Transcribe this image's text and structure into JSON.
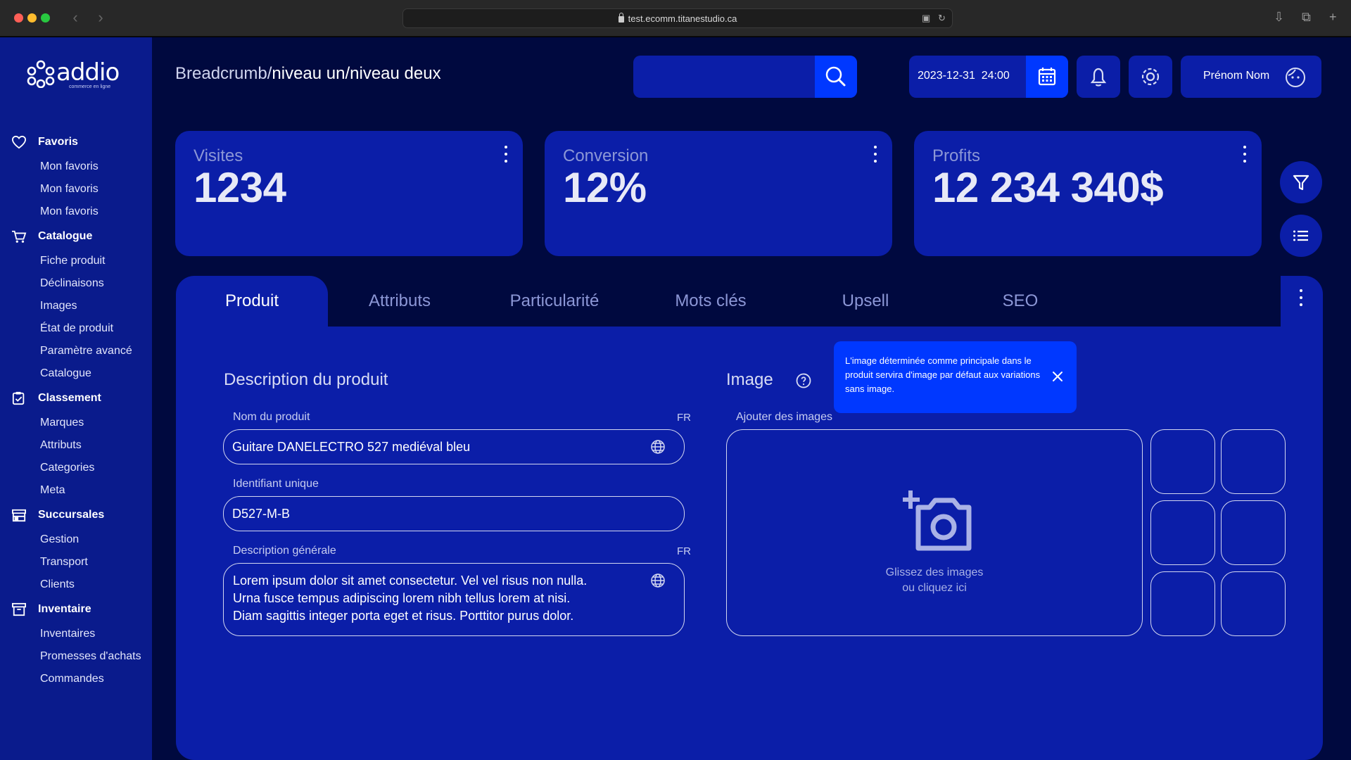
{
  "browser": {
    "url": "test.ecomm.titanestudio.ca"
  },
  "logo": {
    "name": "addio",
    "tagline": "commerce en ligne"
  },
  "sidebar": {
    "sections": [
      {
        "title": "Favoris",
        "icon": "heart-icon",
        "items": [
          "Mon favoris",
          "Mon favoris",
          "Mon favoris"
        ]
      },
      {
        "title": "Catalogue",
        "icon": "cart-icon",
        "items": [
          "Fiche produit",
          "Déclinaisons",
          "Images",
          "État de produit",
          "Paramètre avancé",
          "Catalogue"
        ]
      },
      {
        "title": "Classement",
        "icon": "clipboard-check-icon",
        "items": [
          "Marques",
          "Attributs",
          "Categories",
          "Meta"
        ]
      },
      {
        "title": "Succursales",
        "icon": "store-icon",
        "items": [
          "Gestion",
          "Transport",
          "Clients"
        ]
      },
      {
        "title": "Inventaire",
        "icon": "archive-icon",
        "items": [
          "Inventaires",
          "Promesses d'achats",
          "Commandes"
        ]
      }
    ]
  },
  "header": {
    "breadcrumb": {
      "root": "Breadcrumb/",
      "level1": "niveau un/",
      "level2": "niveau deux"
    },
    "search": {
      "value": "",
      "placeholder": ""
    },
    "date": {
      "value": "2023-12-31",
      "time": "24:00"
    },
    "user": {
      "name": "Prénom Nom"
    }
  },
  "cards": [
    {
      "label": "Visites",
      "value": "1234"
    },
    {
      "label": "Conversion",
      "value": "12%"
    },
    {
      "label": "Profits",
      "value": "12 234 340$"
    }
  ],
  "tabs": [
    "Produit",
    "Attributs",
    "Particularité",
    "Mots clés",
    "Upsell",
    "SEO"
  ],
  "active_tab": "Produit",
  "description": {
    "heading": "Description du produit",
    "name_label": "Nom du produit",
    "name_lang": "FR",
    "name_value": "Guitare DANELECTRO 527 mediéval bleu",
    "id_label": "Identifiant unique",
    "id_value": "D527-M-B",
    "general_label": "Description générale",
    "general_lang": "FR",
    "general_lines": [
      "Lorem ipsum dolor sit amet consectetur. Vel vel risus non nulla.",
      "Urna fusce tempus adipiscing lorem nibh tellus lorem at nisi.",
      "Diam sagittis integer porta eget et risus. Porttitor purus dolor."
    ]
  },
  "image": {
    "heading": "Image",
    "tooltip": "L'image déterminée comme principale dans le produit servira d'image par défaut aux variations sans image.",
    "add_label": "Ajouter des images",
    "drop_line1": "Glissez des images",
    "drop_line2": "ou cliquez ici"
  },
  "colors": {
    "sidebar": "#0a1b8c",
    "background": "#00093f",
    "surface": "#0b1ea8",
    "accent": "#0038ff"
  }
}
